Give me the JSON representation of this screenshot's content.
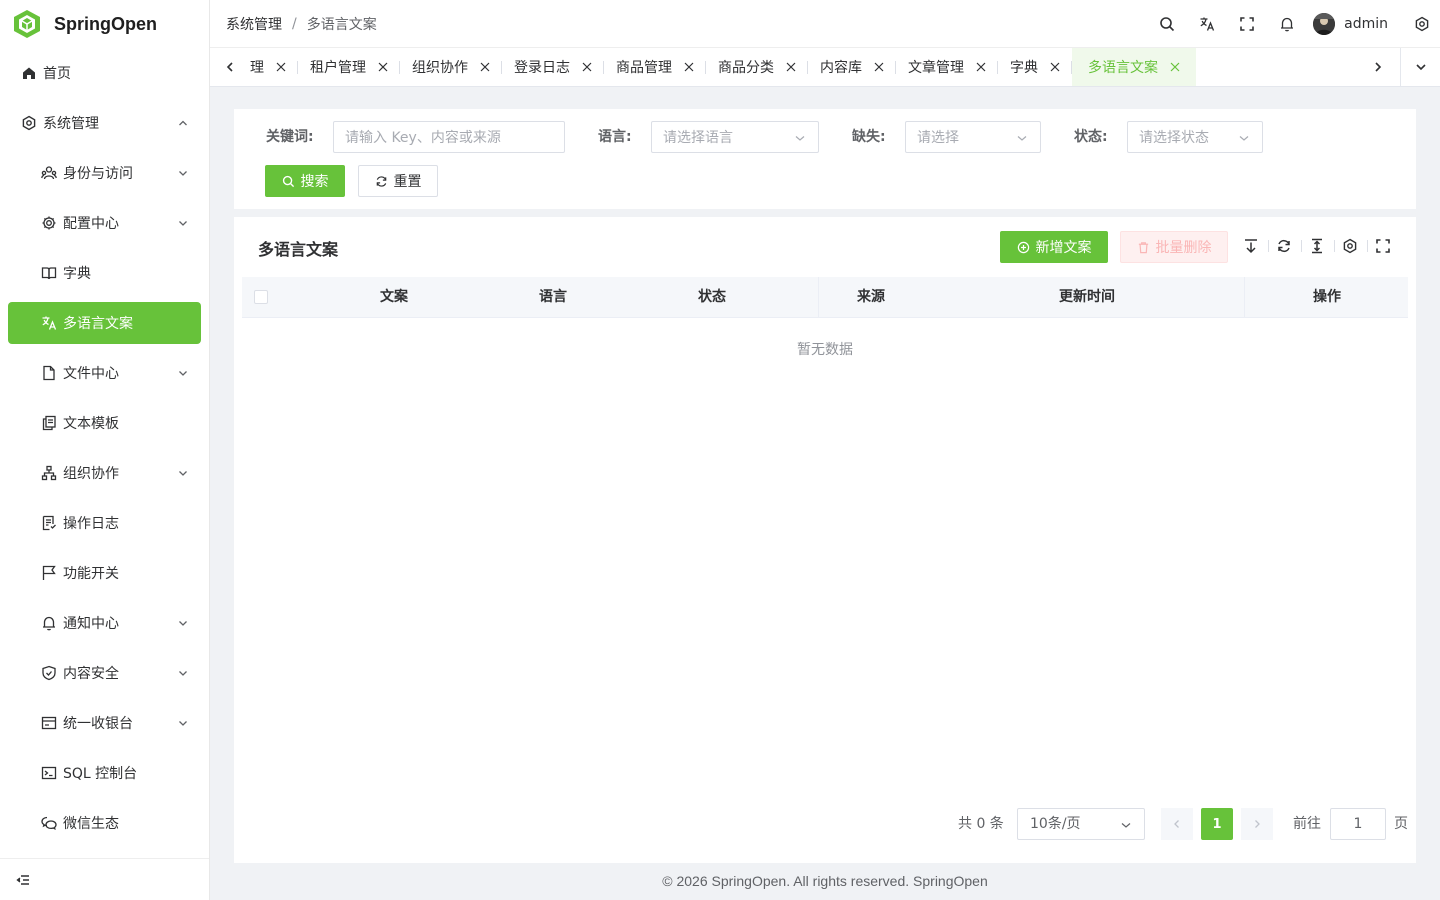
{
  "app": {
    "name": "SpringOpen",
    "brand_color": "#67c23a"
  },
  "sidebar": {
    "items": [
      {
        "label": "首页",
        "icon": "home-icon"
      },
      {
        "label": "系统管理",
        "icon": "gear-icon",
        "expanded": true
      },
      {
        "label": "身份与访问",
        "icon": "users-icon",
        "has_children": true
      },
      {
        "label": "配置中心",
        "icon": "config-icon",
        "has_children": true
      },
      {
        "label": "字典",
        "icon": "book-icon"
      },
      {
        "label": "多语言文案",
        "icon": "translate-icon",
        "active": true
      },
      {
        "label": "文件中心",
        "icon": "file-icon",
        "has_children": true
      },
      {
        "label": "文本模板",
        "icon": "copy-icon"
      },
      {
        "label": "组织协作",
        "icon": "org-icon",
        "has_children": true
      },
      {
        "label": "操作日志",
        "icon": "log-icon"
      },
      {
        "label": "功能开关",
        "icon": "flag-icon"
      },
      {
        "label": "通知中心",
        "icon": "bell-icon",
        "has_children": true
      },
      {
        "label": "内容安全",
        "icon": "shield-icon",
        "has_children": true
      },
      {
        "label": "统一收银台",
        "icon": "cashier-icon",
        "has_children": true
      },
      {
        "label": "SQL 控制台",
        "icon": "terminal-icon"
      },
      {
        "label": "微信生态",
        "icon": "wechat-icon"
      }
    ]
  },
  "header": {
    "breadcrumb": [
      "系统管理",
      "多语言文案"
    ],
    "breadcrumb_sep": "/",
    "user_name": "admin"
  },
  "tabs": {
    "items": [
      "理",
      "租户管理",
      "组织协作",
      "登录日志",
      "商品管理",
      "商品分类",
      "内容库",
      "文章管理",
      "字典",
      "多语言文案"
    ],
    "active_index": 9
  },
  "search": {
    "keyword_label": "关键词:",
    "keyword_placeholder": "请输入 Key、内容或来源",
    "language_label": "语言:",
    "language_placeholder": "请选择语言",
    "missing_label": "缺失:",
    "missing_placeholder": "请选择",
    "status_label": "状态:",
    "status_placeholder": "请选择状态",
    "search_button": "搜索",
    "reset_button": "重置"
  },
  "table": {
    "title": "多语言文案",
    "add_button": "新增文案",
    "batch_delete_button": "批量删除",
    "columns": [
      "文案",
      "语言",
      "状态",
      "来源",
      "更新时间",
      "操作"
    ],
    "rows": [],
    "empty_text": "暂无数据"
  },
  "pagination": {
    "total_text": "共 0 条",
    "page_size": "10条/页",
    "current_page": "1",
    "goto_label": "前往",
    "goto_value": "1",
    "page_suffix": "页"
  },
  "footer": {
    "text": "© 2026 SpringOpen. All rights reserved. SpringOpen"
  }
}
